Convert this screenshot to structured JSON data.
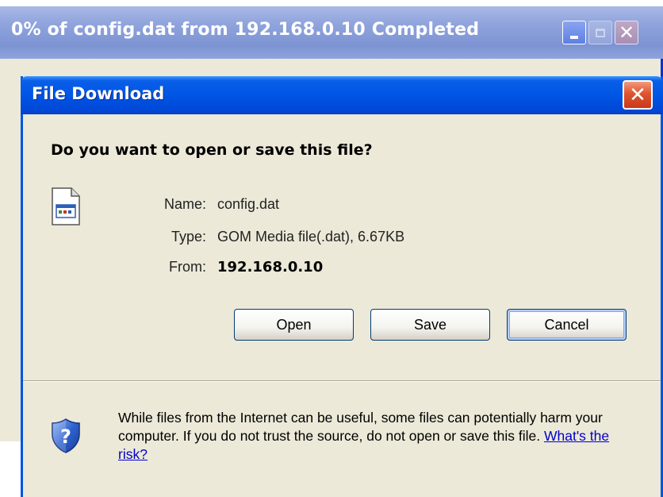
{
  "background_window": {
    "title": "0% of config.dat from 192.168.0.10 Completed",
    "controls": {
      "minimize": "minimize",
      "maximize": "maximize",
      "close": "✕"
    }
  },
  "dialog": {
    "title": "File Download",
    "close_glyph": "✕",
    "question": "Do you want to open or save this file?",
    "file_icon": "document-icon",
    "info": {
      "name_label": "Name:",
      "name_value": "config.dat",
      "type_label": "Type:",
      "type_value": "GOM Media file(.dat), 6.67KB",
      "from_label": "From:",
      "from_value": "192.168.0.10"
    },
    "buttons": {
      "open": "Open",
      "save": "Save",
      "cancel": "Cancel"
    },
    "warning": {
      "icon": "shield-question-icon",
      "text": "While files from the Internet can be useful, some files can potentially harm your computer. If you do not trust the source, do not open or save this file.",
      "link": "What's the risk?"
    }
  },
  "colors": {
    "dialog_title_blue": "#0055e5",
    "face": "#ece9d8",
    "link": "#0000cc",
    "close_red": "#e0542f"
  }
}
